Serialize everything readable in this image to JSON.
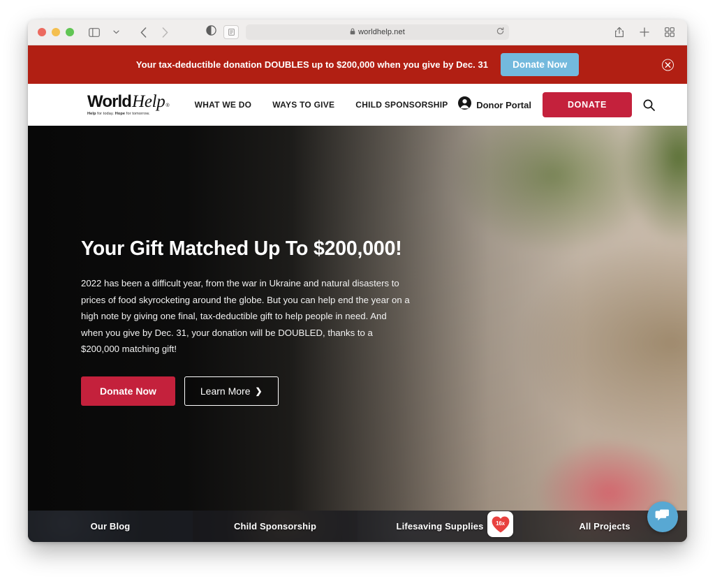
{
  "browser": {
    "traffic_lights": [
      "close",
      "minimize",
      "zoom"
    ],
    "address": {
      "url": "worldhelp.net",
      "lock_icon": "lock-icon",
      "reload_icon": "reload-icon",
      "reader_icon": "reader-view-icon",
      "contrast_icon": "contrast-icon"
    },
    "nav": {
      "sidebar_icon": "sidebar-toggle-icon",
      "sidebar_chevron_icon": "chevron-down-icon",
      "back_icon": "back-arrow-icon",
      "forward_icon": "forward-arrow-icon"
    },
    "right_tools": {
      "share_icon": "share-icon",
      "new_tab_icon": "plus-icon",
      "tab_overview_icon": "tab-grid-icon"
    }
  },
  "promo": {
    "message": "Your tax-deductible donation DOUBLES up to $200,000 when you give by Dec. 31",
    "button_label": "Donate Now",
    "close_icon": "close-circle-icon",
    "background_color": "#b11f13",
    "button_color": "#73b9dd"
  },
  "site_header": {
    "logo": {
      "word_bold": "World",
      "word_italic": "Help",
      "registered_mark": "®",
      "tagline_bold_1": "Help",
      "tagline_rest_1": " for today.",
      "tagline_bold_2": "Hope",
      "tagline_rest_2": " for tomorrow."
    },
    "nav_items": [
      {
        "label": "WHAT WE DO"
      },
      {
        "label": "WAYS TO GIVE"
      },
      {
        "label": "CHILD SPONSORSHIP"
      }
    ],
    "donor_portal": {
      "label": "Donor Portal",
      "icon": "user-circle-icon"
    },
    "donate_button": {
      "label": "DONATE",
      "color": "#c4213c"
    },
    "search": {
      "icon": "search-icon"
    }
  },
  "hero": {
    "title": "Your Gift Matched Up To $200,000!",
    "body": "2022 has been a difficult year, from the war in Ukraine and natural disasters to prices of food skyrocketing around the globe. But you can help end the year on a high note by giving one final, tax-deductible gift to help people in need. And when you give by Dec. 31, your donation will be DOUBLED, thanks to a $200,000 matching gift!",
    "primary_button": {
      "label": "Donate Now",
      "color": "#c4213c"
    },
    "secondary_button": {
      "label": "Learn More",
      "chevron": "❯",
      "icon": "chevron-right-icon"
    }
  },
  "tile_bar": {
    "tiles": [
      {
        "label": "Our Blog"
      },
      {
        "label": "Child Sponsorship"
      },
      {
        "label": "Lifesaving Supplies"
      },
      {
        "label": "All Projects"
      }
    ]
  },
  "heart_badge": {
    "text": "16x",
    "icon": "heart-icon",
    "color": "#e8413f"
  },
  "chat_widget": {
    "icon": "chat-bubble-icon",
    "color": "#58a8d3"
  }
}
